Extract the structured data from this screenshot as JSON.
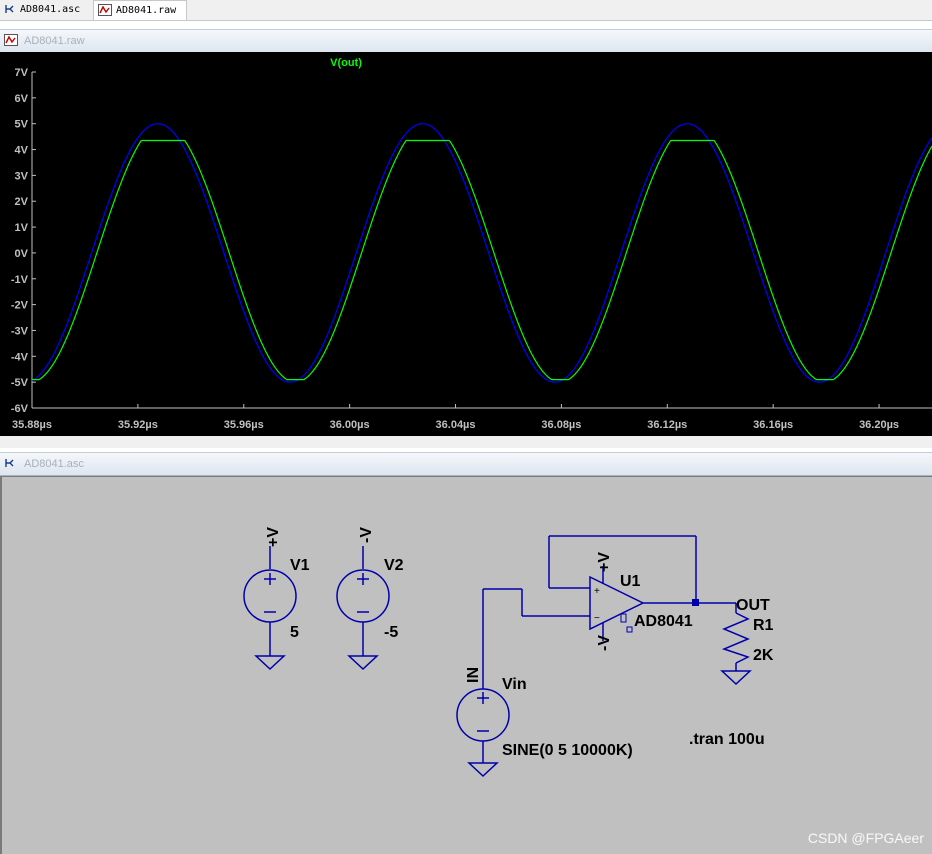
{
  "tabs": [
    {
      "label": "AD8041.asc",
      "icon": "schematic-icon"
    },
    {
      "label": "AD8041.raw",
      "icon": "waveform-icon"
    }
  ],
  "waveform_window": {
    "title": "AD8041.raw",
    "trace_label": "V(out)"
  },
  "schematic_window": {
    "title": "AD8041.asc"
  },
  "chart_data": {
    "type": "line",
    "title": "",
    "xlabel": "",
    "ylabel": "",
    "x_unit": "µs",
    "xlim": [
      35.88,
      36.22
    ],
    "ylim": [
      -6,
      7
    ],
    "x_ticks": [
      "35.88µs",
      "35.92µs",
      "35.96µs",
      "36.00µs",
      "36.04µs",
      "36.08µs",
      "36.12µs",
      "36.16µs",
      "36.20µs"
    ],
    "y_ticks": [
      "7V",
      "6V",
      "5V",
      "4V",
      "3V",
      "2V",
      "1V",
      "0V",
      "-1V",
      "-2V",
      "-3V",
      "-4V",
      "-5V",
      "-6V"
    ],
    "legend": "top-center",
    "series": [
      {
        "name": "V(out)",
        "color": "#00ff00",
        "description_values": {
          "period_us": 0.1,
          "max_V": 4.35,
          "min_V": -4.9,
          "lag_us": 0.002
        }
      },
      {
        "name": "",
        "color": "#0000ff",
        "description_values": {
          "period_us": 0.1,
          "amplitude_V": 5,
          "peak_at_us": 35.9275
        }
      }
    ]
  },
  "schematic": {
    "V1": {
      "name": "V1",
      "value": "5",
      "net": "+V"
    },
    "V2": {
      "name": "V2",
      "value": "-5",
      "net": "-V"
    },
    "Vin": {
      "name": "Vin",
      "value": "SINE(0 5 10000K)",
      "net": "IN"
    },
    "U1": {
      "name": "U1",
      "model": "AD8041",
      "pos_supply": "+V",
      "neg_supply": "-V",
      "plus": "+",
      "minus": "−"
    },
    "R1": {
      "name": "R1",
      "value": "2K"
    },
    "out_net": "OUT",
    "directive": ".tran 100u"
  },
  "watermark": "CSDN @FPGAeer",
  "colors": {
    "wire": "#0000aa",
    "grid_bg": "#000000",
    "axis_text": "#c0c0c0",
    "trace_out": "#00ff00",
    "trace_in": "#0000ff"
  }
}
